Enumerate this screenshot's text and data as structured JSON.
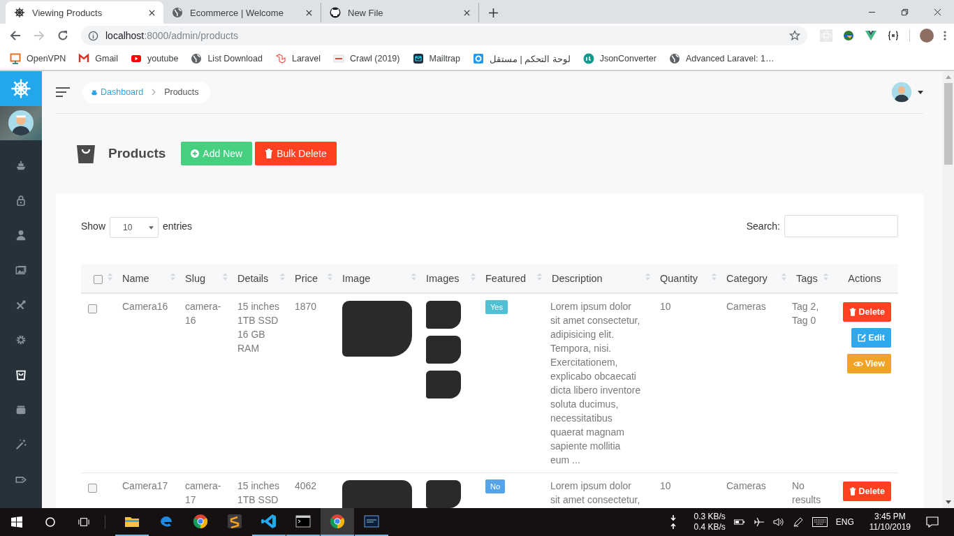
{
  "browser": {
    "tabs": [
      {
        "title": "Viewing Products",
        "selected": true
      },
      {
        "title": "Ecommerce | Welcome",
        "selected": false
      },
      {
        "title": "New File",
        "selected": false
      }
    ],
    "forward_enabled": false,
    "address": {
      "host": "localhost",
      "rest": ":8000/admin/products"
    },
    "bookmarks": [
      {
        "label": "OpenVPN"
      },
      {
        "label": "Gmail"
      },
      {
        "label": "youtube"
      },
      {
        "label": "List Download"
      },
      {
        "label": "Laravel"
      },
      {
        "label": "Crawl (2019)"
      },
      {
        "label": "Mailtrap"
      },
      {
        "label": "لوحة التحكم | مستقل"
      },
      {
        "label": "JsonConverter"
      },
      {
        "label": "Advanced Laravel: 1…"
      }
    ]
  },
  "sidebar": {
    "items": [
      {
        "selected": false
      },
      {
        "selected": false
      },
      {
        "selected": false
      },
      {
        "selected": false
      },
      {
        "selected": false
      },
      {
        "selected": false
      },
      {
        "selected": true
      },
      {
        "selected": false
      },
      {
        "selected": false
      },
      {
        "selected": false
      }
    ]
  },
  "topbar": {
    "breadcrumb": [
      {
        "label": "Dashboard",
        "link": true
      },
      {
        "label": "Products",
        "link": false
      }
    ]
  },
  "page": {
    "title": "Products",
    "buttons": [
      {
        "kind": "add",
        "label": "Add New"
      },
      {
        "kind": "bulk-delete",
        "label": "Bulk Delete"
      }
    ]
  },
  "table": {
    "show_label": "Show",
    "length_value": "10",
    "entries_label": "entries",
    "search_label": "Search:",
    "select_all_checked": false,
    "columns": [
      {
        "kind": "checkbox",
        "sortable": true
      },
      {
        "kind": "text",
        "label": "Name",
        "sortable": true
      },
      {
        "kind": "text",
        "label": "Slug",
        "sortable": true
      },
      {
        "kind": "text",
        "label": "Details",
        "sortable": true
      },
      {
        "kind": "text",
        "label": "Price",
        "sortable": true
      },
      {
        "kind": "text",
        "label": "Image",
        "sortable": true
      },
      {
        "kind": "text",
        "label": "Images",
        "sortable": true
      },
      {
        "kind": "text",
        "label": "Featured",
        "sortable": true
      },
      {
        "kind": "text",
        "label": "Description",
        "sortable": true
      },
      {
        "kind": "text",
        "label": "Quantity",
        "sortable": true
      },
      {
        "kind": "text",
        "label": "Category",
        "sortable": true
      },
      {
        "kind": "text",
        "label": "Tags",
        "sortable": true
      },
      {
        "kind": "text",
        "label": "Actions",
        "sortable": false
      }
    ],
    "rows": [
      {
        "checked": false,
        "name": "Camera16",
        "slug": "camera-16",
        "details": "15 inches 1TB SSD 16 GB RAM",
        "price": "1870",
        "image": {
          "kind": "photo"
        },
        "images": [
          {
            "kind": "photo"
          },
          {
            "kind": "photo"
          },
          {
            "kind": "photo"
          }
        ],
        "featured": true,
        "featured_label": "Yes",
        "description": "Lorem ipsum dolor sit amet consectetur, adipisicing elit. Tempora, nisi. Exercitationem, explicabo obcaecati dicta libero inventore soluta ducimus, necessitatibus quaerat magnam sapiente mollitia eum ...",
        "quantity": "10",
        "category": "Cameras",
        "tags": "Tag 2, Tag 0",
        "actions": [
          {
            "kind": "delete",
            "label": "Delete"
          },
          {
            "kind": "edit",
            "label": "Edit"
          },
          {
            "kind": "view",
            "label": "View"
          }
        ]
      },
      {
        "checked": false,
        "name": "Camera17",
        "slug": "camera-17",
        "details": "15 inches 1TB SSD",
        "price": "4062",
        "image": {
          "kind": "photo"
        },
        "images": [
          {
            "kind": "photo"
          }
        ],
        "featured": false,
        "featured_label": "No",
        "description": "Lorem ipsum dolor sit amet consectetur,",
        "quantity": "10",
        "category": "Cameras",
        "tags": "No results",
        "actions": [
          {
            "kind": "delete",
            "label": "Delete"
          }
        ]
      }
    ]
  },
  "taskbar": {
    "apps": [
      {
        "running": true,
        "selected": false
      },
      {
        "running": false,
        "selected": false
      },
      {
        "running": false,
        "selected": false
      },
      {
        "running": false,
        "selected": false
      },
      {
        "running": true,
        "selected": false
      },
      {
        "running": true,
        "selected": false
      },
      {
        "running": true,
        "selected": true
      },
      {
        "running": true,
        "selected": false
      }
    ],
    "upload": "0.3 KB/s",
    "download": "0.4 KB/s",
    "language": "ENG",
    "time": "3:45 PM",
    "date": "11/10/2019"
  }
}
